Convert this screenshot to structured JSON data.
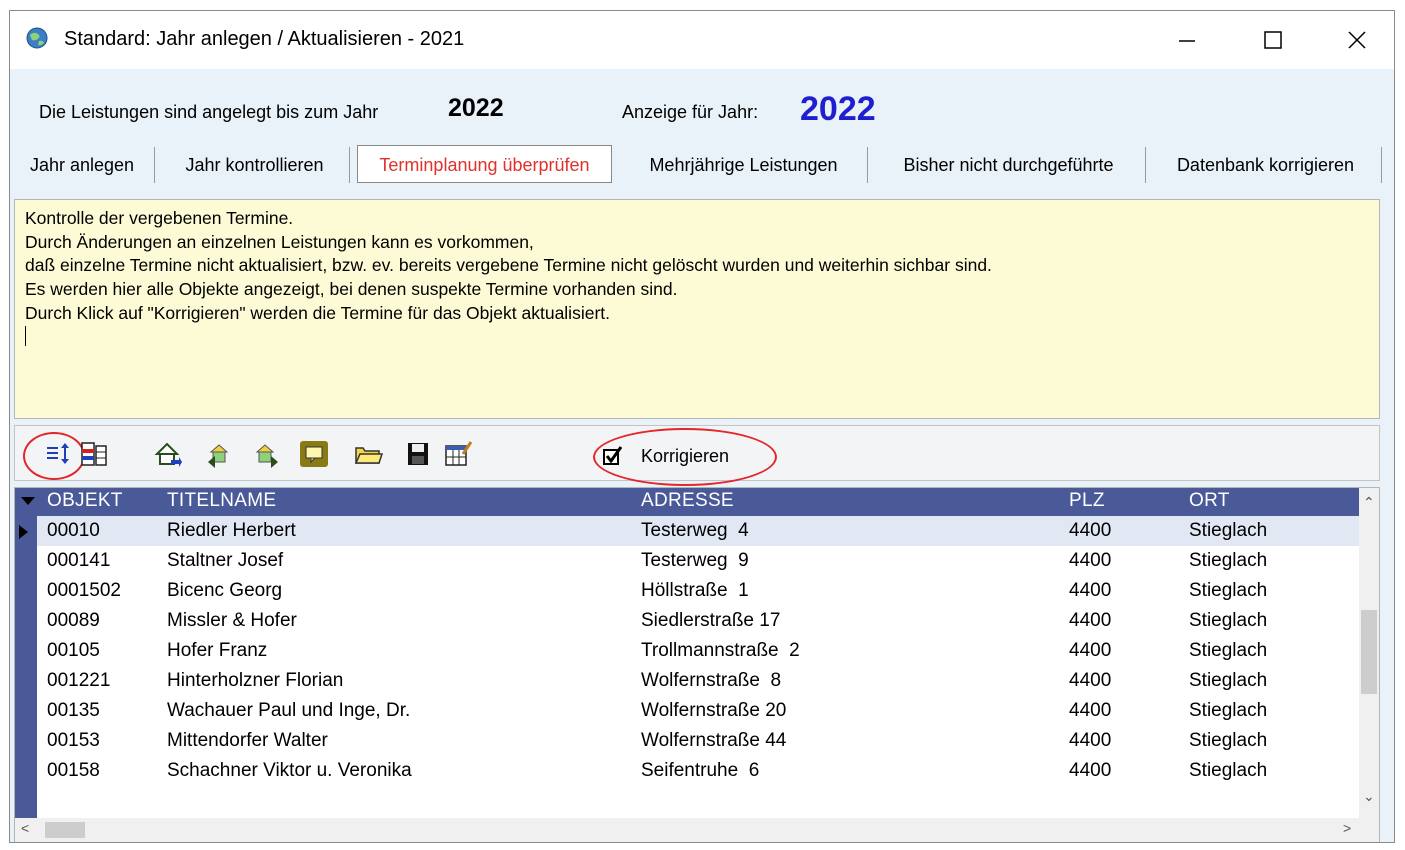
{
  "window": {
    "title": "Standard: Jahr anlegen / Aktualisieren - 2021",
    "controls": [
      "minimize",
      "maximize",
      "close"
    ]
  },
  "header": {
    "label_created": "Die Leistungen sind angelegt bis zum Jahr",
    "year_created": "2022",
    "label_display": "Anzeige für Jahr:",
    "year_display": "2022"
  },
  "tabs": [
    {
      "label": "Jahr anlegen"
    },
    {
      "label": "Jahr kontrollieren"
    },
    {
      "label": "Terminplanung überprüfen",
      "active": true
    },
    {
      "label": "Mehrjährige Leistungen"
    },
    {
      "label": "Bisher nicht durchgeführte"
    },
    {
      "label": "Datenbank korrigieren"
    }
  ],
  "description": {
    "lines": [
      "Kontrolle der vergebenen Termine.",
      "",
      "Durch Änderungen an einzelnen Leistungen kann es vorkommen,",
      "daß einzelne Termine nicht aktualisiert, bzw. ev. bereits vergebene Termine nicht gelöscht wurden und weiterhin sichbar sind.",
      "",
      "Es werden hier alle Objekte angezeigt, bei denen suspekte Termine vorhanden sind.",
      "Durch Klick auf \"Korrigieren\" werden die Termine für das Objekt aktualisiert."
    ]
  },
  "toolbar": {
    "icons": [
      "sort-icon",
      "columns-icon",
      "home-icon",
      "prev-record-icon",
      "next-record-icon",
      "comment-icon",
      "open-folder-icon",
      "save-icon",
      "edit-table-icon"
    ],
    "korrigieren_label": "Korrigieren",
    "korrigieren_checked": true
  },
  "grid": {
    "columns": [
      "OBJEKT",
      "TITELNAME",
      "ADRESSE",
      "PLZ",
      "ORT"
    ],
    "rows": [
      {
        "objekt": "00010",
        "titelname": "Riedler Herbert",
        "adresse": "Testerweg  4",
        "plz": "4400",
        "ort": "Stieglach"
      },
      {
        "objekt": "000141",
        "titelname": "Staltner Josef",
        "adresse": "Testerweg  9",
        "plz": "4400",
        "ort": "Stieglach"
      },
      {
        "objekt": "0001502",
        "titelname": "Bicenc Georg",
        "adresse": "Höllstraße  1",
        "plz": "4400",
        "ort": "Stieglach"
      },
      {
        "objekt": "00089",
        "titelname": "Missler & Hofer",
        "adresse": "Siedlerstraße 17",
        "plz": "4400",
        "ort": "Stieglach"
      },
      {
        "objekt": "00105",
        "titelname": "Hofer Franz",
        "adresse": "Trollmannstraße  2",
        "plz": "4400",
        "ort": "Stieglach"
      },
      {
        "objekt": "001221",
        "titelname": "Hinterholzner Florian",
        "adresse": "Wolfernstraße  8",
        "plz": "4400",
        "ort": "Stieglach"
      },
      {
        "objekt": "00135",
        "titelname": "Wachauer Paul und Inge, Dr.",
        "adresse": "Wolfernstraße 20",
        "plz": "4400",
        "ort": "Stieglach"
      },
      {
        "objekt": "00153",
        "titelname": "Mittendorfer Walter",
        "adresse": "Wolfernstraße 44",
        "plz": "4400",
        "ort": "Stieglach"
      },
      {
        "objekt": "00158",
        "titelname": "Schachner Viktor u. Veronika",
        "adresse": "Seifentruhe  6",
        "plz": "4400",
        "ort": "Stieglach"
      }
    ],
    "selected_row": 0
  },
  "colors": {
    "grid_header": "#4a5998",
    "description_bg": "#fcfbd6",
    "active_tab_text": "#e0312b",
    "year_display": "#1f1fd1",
    "annotation_ring": "#e2262a"
  }
}
